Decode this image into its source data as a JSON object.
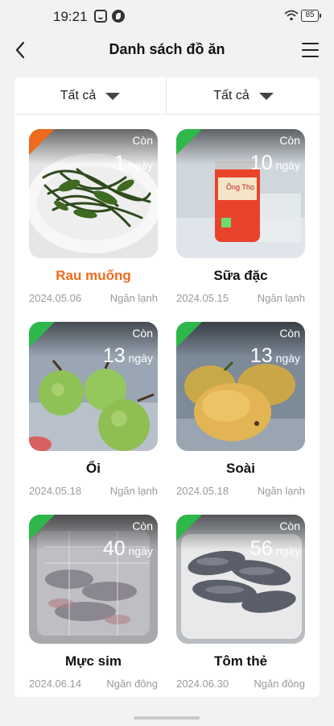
{
  "status_bar": {
    "time": "19:21",
    "battery": "85",
    "icons": [
      "app-notification-icon",
      "app-notification-icon-2",
      "wifi-icon",
      "battery-icon"
    ]
  },
  "header": {
    "title": "Danh sách đồ ăn",
    "back_icon": "chevron-left-icon",
    "menu_icon": "hamburger-menu-icon"
  },
  "filters": [
    {
      "label": "Tất cả",
      "icon": "caret-down-icon"
    },
    {
      "label": "Tất cả",
      "icon": "caret-down-icon"
    }
  ],
  "colors": {
    "ok": "#2eb84a",
    "warning": "#f06a1d",
    "muted_text": "#9a9a9a"
  },
  "foods": [
    {
      "name": "Rau muống",
      "remain_label": "Còn",
      "days": "1",
      "days_unit": "ngày",
      "date": "2024.05.06",
      "storage": "Ngăn lạnh",
      "status": "warning"
    },
    {
      "name": "Sữa đặc",
      "remain_label": "Còn",
      "days": "10",
      "days_unit": "ngày",
      "date": "2024.05.15",
      "storage": "Ngăn lạnh",
      "status": "ok",
      "photo_text": "Ông Thọ"
    },
    {
      "name": "Ổi",
      "remain_label": "Còn",
      "days": "13",
      "days_unit": "ngày",
      "date": "2024.05.18",
      "storage": "Ngăn lạnh",
      "status": "ok"
    },
    {
      "name": "Soài",
      "remain_label": "Còn",
      "days": "13",
      "days_unit": "ngày",
      "date": "2024.05.18",
      "storage": "Ngăn lạnh",
      "status": "ok"
    },
    {
      "name": "Mực sim",
      "remain_label": "Còn",
      "days": "40",
      "days_unit": "ngày",
      "date": "2024.06.14",
      "storage": "Ngăn đông",
      "status": "ok"
    },
    {
      "name": "Tôm thẻ",
      "remain_label": "Còn",
      "days": "56",
      "days_unit": "ngày",
      "date": "2024.06.30",
      "storage": "Ngăn đông",
      "status": "ok"
    }
  ]
}
